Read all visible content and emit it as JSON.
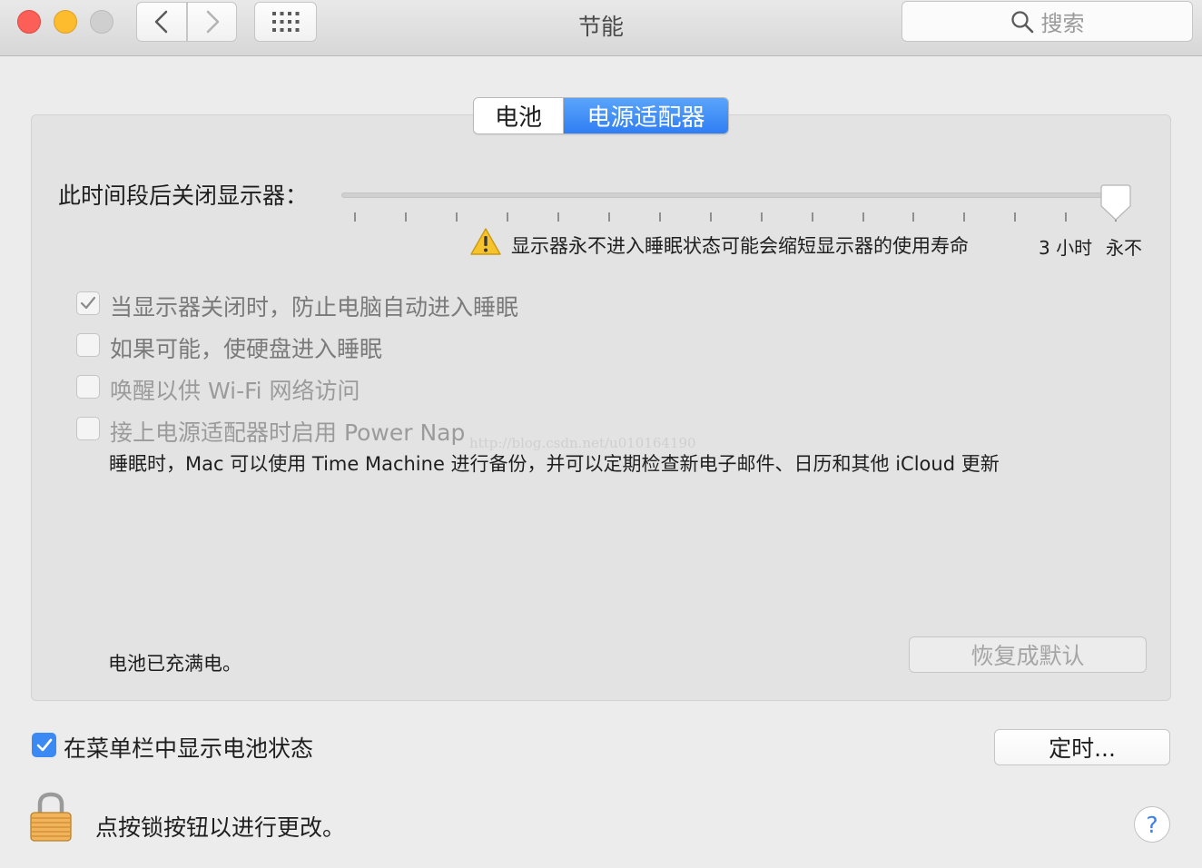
{
  "window": {
    "title": "节能"
  },
  "search": {
    "placeholder": "搜索"
  },
  "tabs": [
    {
      "label": "电池",
      "selected": false
    },
    {
      "label": "电源适配器",
      "selected": true
    }
  ],
  "display_sleep": {
    "label": "此时间段后关闭显示器：",
    "tick_labels": [
      "3 小时",
      "永不"
    ],
    "value": "永不",
    "warning": "显示器永不进入睡眠状态可能会缩短显示器的使用寿命"
  },
  "options": [
    {
      "label": "当显示器关闭时，防止电脑自动进入睡眠",
      "checked": true,
      "enabled": false
    },
    {
      "label": "如果可能，使硬盘进入睡眠",
      "checked": false,
      "enabled": false
    },
    {
      "label": "唤醒以供 Wi-Fi 网络访问",
      "checked": false,
      "enabled": false
    },
    {
      "label": "接上电源适配器时启用 Power Nap",
      "checked": false,
      "enabled": false
    }
  ],
  "power_nap_description": "睡眠时，Mac 可以使用 Time Machine 进行备份，并可以定期检查新电子邮件、日历和其他 iCloud 更新",
  "watermark": "http://blog.csdn.net/u010164190",
  "battery_status": "电池已充满电。",
  "buttons": {
    "restore_defaults": "恢复成默认",
    "schedule": "定时..."
  },
  "menu_bar_option": {
    "label": "在菜单栏中显示电池状态",
    "checked": true
  },
  "lock": {
    "text": "点按锁按钮以进行更改。"
  },
  "help": {
    "label": "?"
  },
  "colors": {
    "accent": "#3b8af4",
    "segment_selected": "#2f7ef4",
    "close": "#fc5f57",
    "minimize": "#fdbc2e"
  }
}
